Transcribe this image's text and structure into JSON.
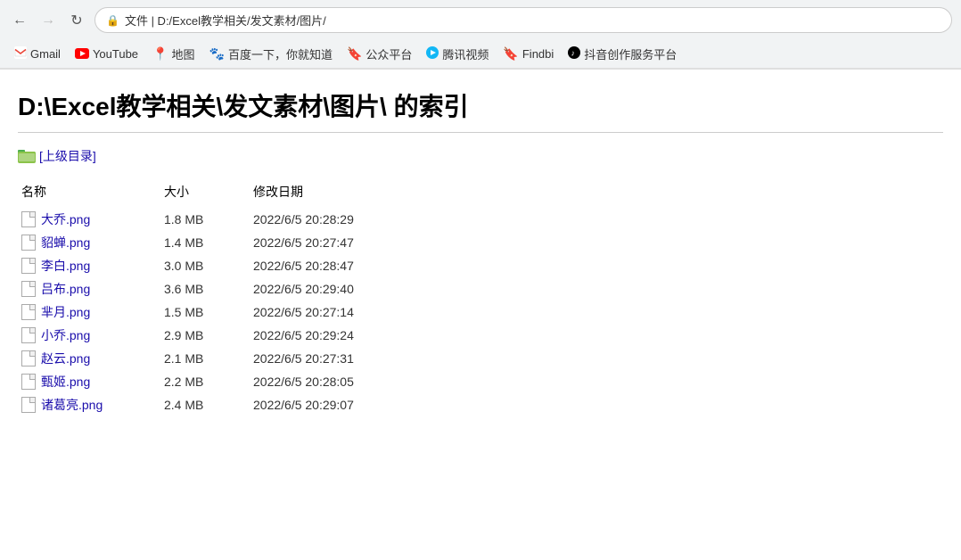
{
  "browser": {
    "address": "文件 | D:/Excel教学相关/发文素材/图片/",
    "back_disabled": false,
    "forward_disabled": true
  },
  "bookmarks": [
    {
      "id": "gmail",
      "icon": "M",
      "icon_color": "#EA4335",
      "label": "Gmail"
    },
    {
      "id": "youtube",
      "icon": "▶",
      "icon_color": "#FF0000",
      "label": "YouTube"
    },
    {
      "id": "maps",
      "icon": "📍",
      "icon_color": "#34A853",
      "label": "地图"
    },
    {
      "id": "baidu",
      "icon": "🐾",
      "icon_color": "#2932E1",
      "label": "百度一下，你就知道"
    },
    {
      "id": "gongzhong",
      "icon": "🔖",
      "icon_color": "#FFC107",
      "label": "公众平台"
    },
    {
      "id": "tencent",
      "icon": "▶",
      "icon_color": "#12B7F5",
      "label": "腾讯视频"
    },
    {
      "id": "findbi",
      "icon": "🔖",
      "icon_color": "#FFA000",
      "label": "Findbi"
    },
    {
      "id": "douyin",
      "icon": "♪",
      "icon_color": "#000000",
      "label": "抖音创作服务平台"
    }
  ],
  "page": {
    "title": "D:\\Excel教学相关\\发文素材\\图片\\ 的索引",
    "parent_dir_label": "[上级目录]",
    "columns": {
      "name": "名称",
      "size": "大小",
      "date": "修改日期"
    },
    "files": [
      {
        "name": "大乔.png",
        "size": "1.8 MB",
        "date": "2022/6/5 20:28:29"
      },
      {
        "name": "貂蝉.png",
        "size": "1.4 MB",
        "date": "2022/6/5 20:27:47"
      },
      {
        "name": "李白.png",
        "size": "3.0 MB",
        "date": "2022/6/5 20:28:47"
      },
      {
        "name": "吕布.png",
        "size": "3.6 MB",
        "date": "2022/6/5 20:29:40"
      },
      {
        "name": "芈月.png",
        "size": "1.5 MB",
        "date": "2022/6/5 20:27:14"
      },
      {
        "name": "小乔.png",
        "size": "2.9 MB",
        "date": "2022/6/5 20:29:24"
      },
      {
        "name": "赵云.png",
        "size": "2.1 MB",
        "date": "2022/6/5 20:27:31"
      },
      {
        "name": "甄姬.png",
        "size": "2.2 MB",
        "date": "2022/6/5 20:28:05"
      },
      {
        "name": "诸葛亮.png",
        "size": "2.4 MB",
        "date": "2022/6/5 20:29:07"
      }
    ]
  }
}
